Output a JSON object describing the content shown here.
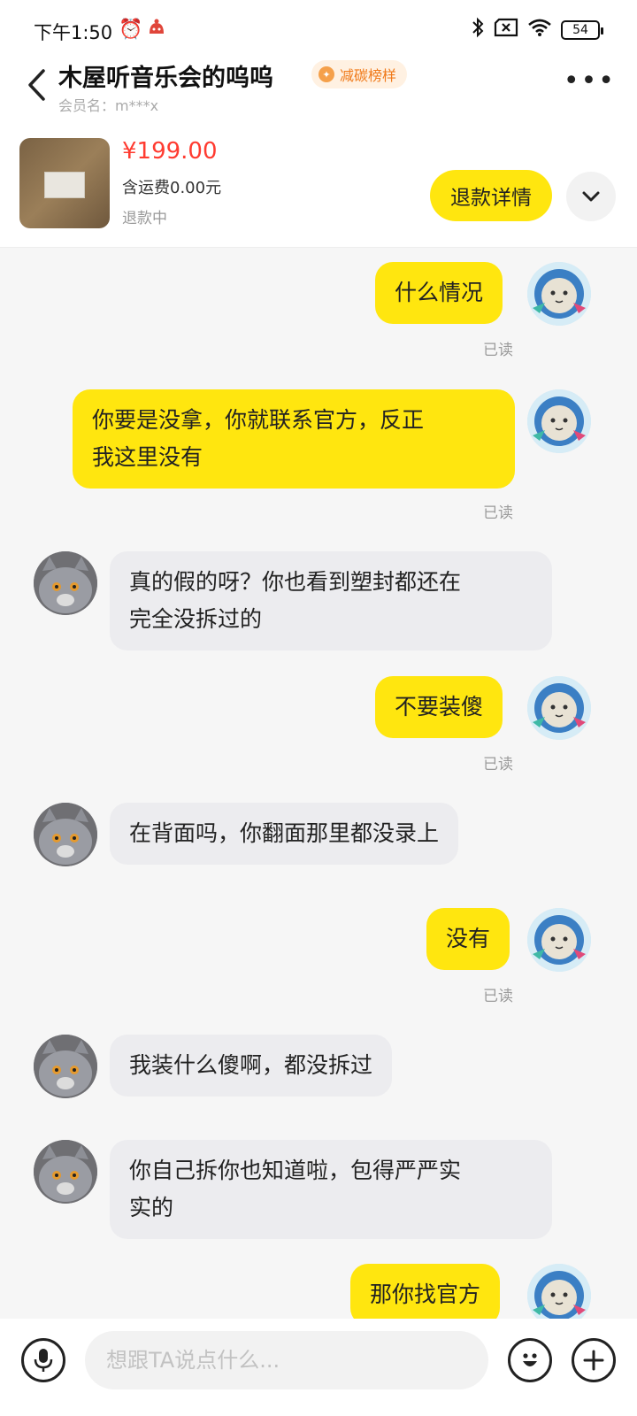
{
  "status_bar": {
    "time": "下午1:50",
    "battery": "54",
    "icons": [
      "alarm-icon",
      "app-notification-icon",
      "bluetooth-icon",
      "no-sim-icon",
      "wifi-icon",
      "battery-icon"
    ]
  },
  "header": {
    "contact_name": "木屋听音乐会的呜呜",
    "badge": "减碳榜样",
    "member_label": "会员名：m***x"
  },
  "product": {
    "price": "¥199.00",
    "shipping": "含运费0.00元",
    "status": "退款中",
    "refund_button": "退款详情"
  },
  "messages": [
    {
      "from": "me",
      "lines": [
        "什么情况"
      ],
      "read": "已读"
    },
    {
      "from": "me",
      "lines": [
        "你要是没拿，你就联系官方，反正",
        "我这里没有"
      ],
      "read": "已读"
    },
    {
      "from": "other",
      "lines": [
        "真的假的呀？你也看到塑封都还在",
        "完全没拆过的"
      ]
    },
    {
      "from": "me",
      "lines": [
        "不要装傻"
      ],
      "read": "已读"
    },
    {
      "from": "other",
      "lines": [
        "在背面吗，你翻面那里都没录上"
      ]
    },
    {
      "from": "me",
      "lines": [
        "没有"
      ],
      "read": "已读"
    },
    {
      "from": "other",
      "lines": [
        "我装什么傻啊，都没拆过"
      ]
    },
    {
      "from": "other",
      "lines": [
        "你自己拆你也知道啦，包得严严实",
        "实的"
      ]
    },
    {
      "from": "me",
      "lines": [
        "那你找官方"
      ]
    }
  ],
  "input_bar": {
    "placeholder": "想跟TA说点什么..."
  },
  "colors": {
    "accent_yellow": "#ffe60f",
    "price_red": "#ff3b30",
    "badge_orange": "#f07a1a",
    "incoming_bubble": "#ececef"
  }
}
